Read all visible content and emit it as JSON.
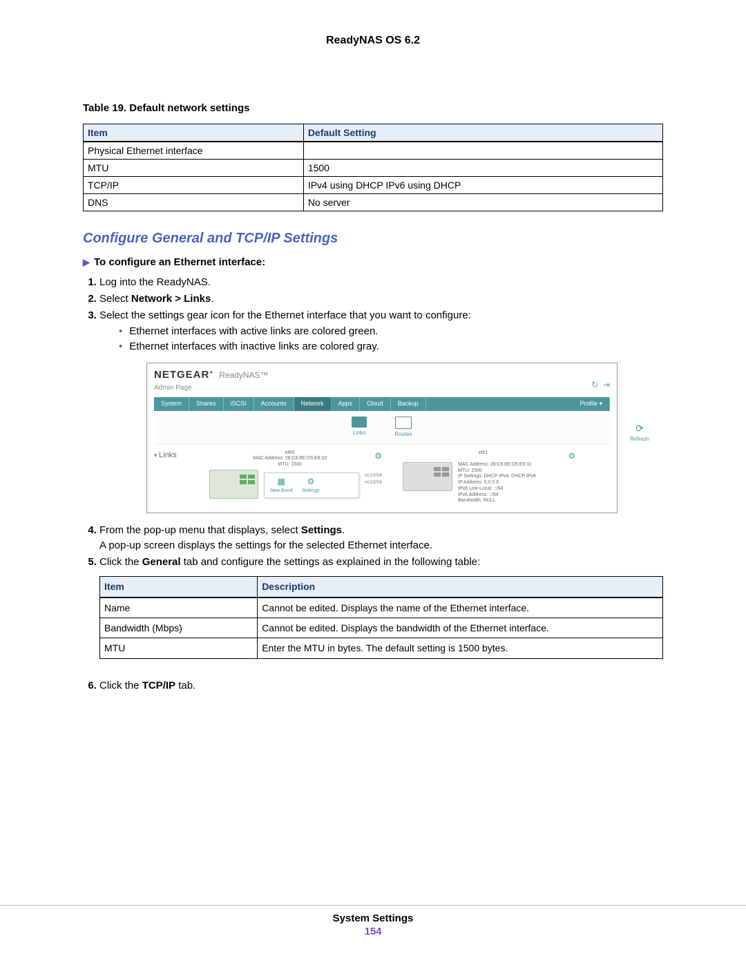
{
  "header": {
    "title": "ReadyNAS OS 6.2"
  },
  "table1": {
    "caption": "Table 19. Default network settings",
    "headers": [
      "Item",
      "Default Setting"
    ],
    "rows": [
      [
        "Physical Ethernet interface",
        ""
      ],
      [
        "MTU",
        "1500"
      ],
      [
        "TCP/IP",
        "IPv4 using DHCP IPv6 using DHCP"
      ],
      [
        "DNS",
        "No server"
      ]
    ]
  },
  "section_heading": "Configure General and TCP/IP Settings",
  "proc_intro": "To configure an Ethernet interface:",
  "steps": {
    "s1": "Log into the ReadyNAS.",
    "s2_pre": "Select ",
    "s2_bold": "Network > Links",
    "s2_post": ".",
    "s3": "Select the settings gear icon for the Ethernet interface that you want to configure:",
    "s3_sub_a": "Ethernet interfaces with active links are colored green.",
    "s3_sub_b": "Ethernet interfaces with inactive links are colored gray.",
    "s4_pre": "From the pop-up menu that displays, select ",
    "s4_bold": "Settings",
    "s4_post": ".",
    "s4_line2": "A pop-up screen displays the settings for the selected Ethernet interface.",
    "s5_pre": "Click the ",
    "s5_bold": "General",
    "s5_post": " tab and configure the settings as explained in the following table:",
    "s6_pre": "Click the ",
    "s6_bold": "TCP/IP",
    "s6_post": " tab."
  },
  "table2": {
    "headers": [
      "Item",
      "Description"
    ],
    "rows": [
      [
        "Name",
        "Cannot be edited. Displays the name of the Ethernet interface."
      ],
      [
        "Bandwidth (Mbps)",
        "Cannot be edited. Displays the bandwidth of the Ethernet interface."
      ],
      [
        "MTU",
        "Enter the MTU in bytes. The default setting is 1500 bytes."
      ]
    ]
  },
  "screenshot": {
    "brand": "NETGEAR",
    "product": "ReadyNAS™",
    "admin": "Admin Page",
    "tabs": [
      "System",
      "Shares",
      "iSCSI",
      "Accounts",
      "Network",
      "Apps",
      "Cloud",
      "Backup"
    ],
    "profile_tab": "Profile ▾",
    "subtabs": {
      "links": "Links",
      "routes": "Routes",
      "refresh": "Refresh"
    },
    "side_label": "Links",
    "popup": {
      "newbond": "New Bond",
      "settings": "Settings"
    },
    "eth0": {
      "name": "eth0",
      "mac": "MAC Address: 28:C6:8E:D5:E8:10",
      "mtu": "MTU: 1500",
      "extra1": "ec10/64",
      "extra2": "ec10/64"
    },
    "eth1": {
      "name": "eth1",
      "mac": "MAC Address: 28:C6:8E:D5:E8:11",
      "mtu": "MTU: 1500",
      "ip_settings": "IP Settings: DHCP IPv4, DHCP IPv6",
      "ip_addr": "IP Address: 0.0.0.0",
      "ipv6ll": "IPv6 Link-Local: ::/64",
      "ipv6": "IPv6 Address: ::/64",
      "bw": "Bandwidth: NULL"
    }
  },
  "footer": {
    "label": "System Settings",
    "page": "154"
  }
}
